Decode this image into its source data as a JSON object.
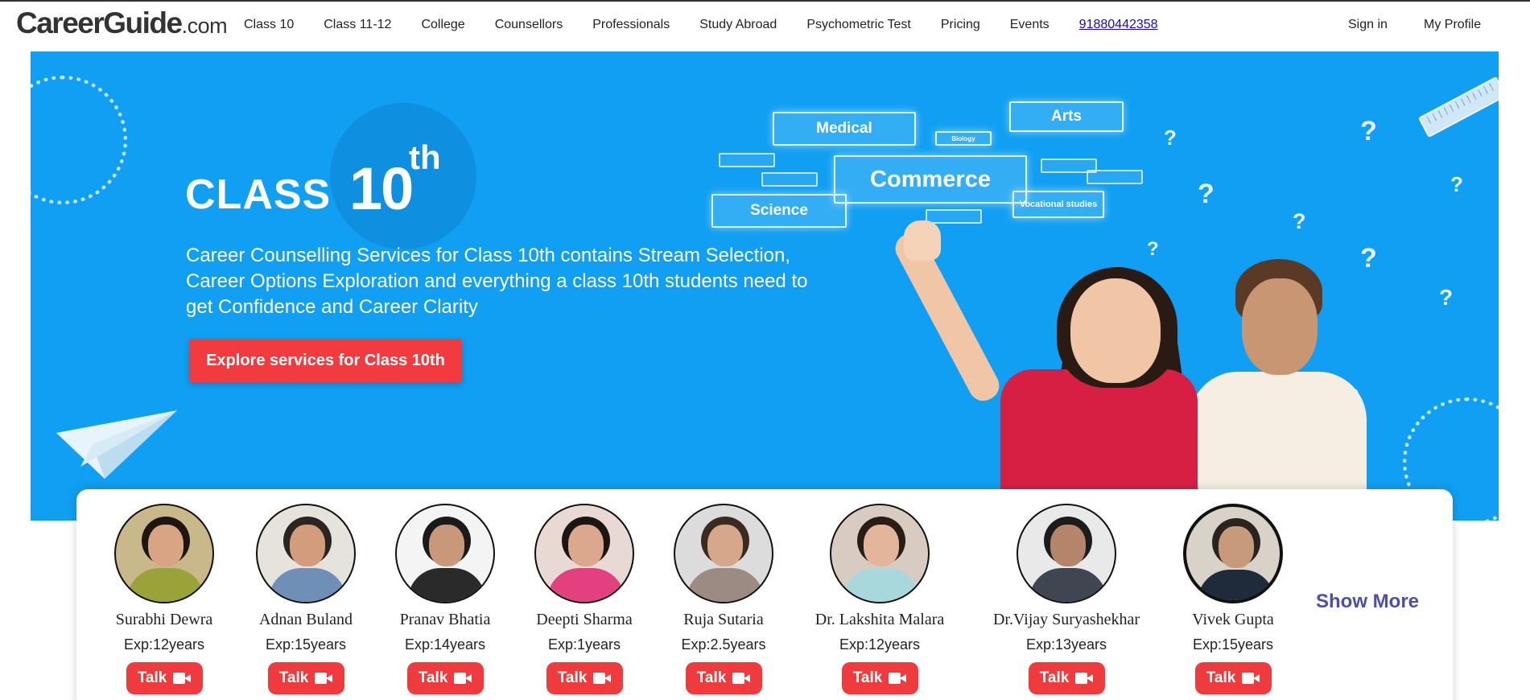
{
  "logo": {
    "main": "CareerGuide",
    "suffix": ".com"
  },
  "nav": {
    "links": [
      "Class 10",
      "Class 11-12",
      "College",
      "Counsellors",
      "Professionals",
      "Study Abroad",
      "Psychometric Test",
      "Pricing",
      "Events"
    ],
    "phone": "91880442358",
    "sign_in": "Sign in",
    "my_profile": "My Profile"
  },
  "hero": {
    "class_word": "CLASS",
    "class_number": "10",
    "class_suffix": "th",
    "description": "Career Counselling Services for Class 10th contains Stream Selection, Career Options Exploration and everything a class 10th students need to get Confidence and Career Clarity",
    "cta": "Explore services for Class 10th",
    "stream_tags": {
      "medical": "Medical",
      "biology": "Biology",
      "arts": "Arts",
      "commerce": "Commerce",
      "science": "Science",
      "vocational": "Vocational studies"
    },
    "question_mark": "?",
    "colors": {
      "background": "#109ff2",
      "cta": "#f23b3f"
    }
  },
  "counsellors": {
    "talk_label": "Talk",
    "show_more": "Show More",
    "items": [
      {
        "name": "Surabhi Dewra",
        "exp": "Exp:12years"
      },
      {
        "name": "Adnan Buland",
        "exp": "Exp:15years"
      },
      {
        "name": "Pranav Bhatia",
        "exp": "Exp:14years"
      },
      {
        "name": "Deepti Sharma",
        "exp": "Exp:1years"
      },
      {
        "name": "Ruja Sutaria",
        "exp": "Exp:2.5years"
      },
      {
        "name": "Dr. Lakshita Malara",
        "exp": "Exp:12years"
      },
      {
        "name": "Dr.Vijay Suryashekhar",
        "exp": "Exp:13years"
      },
      {
        "name": "Vivek Gupta",
        "exp": "Exp:15years"
      }
    ]
  }
}
